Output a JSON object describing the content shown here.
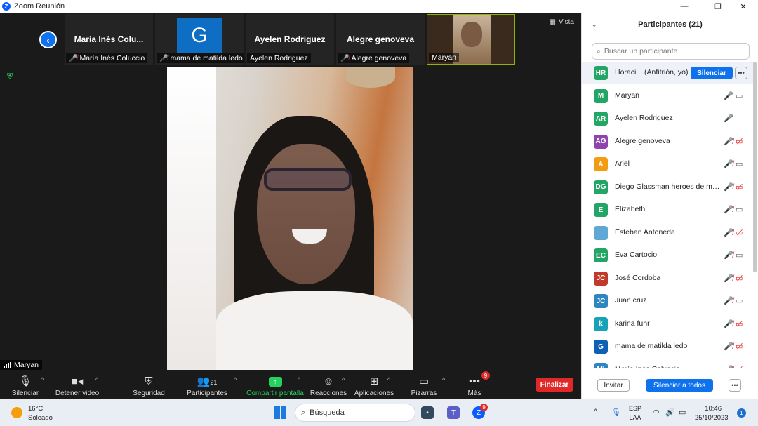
{
  "window": {
    "title": "Zoom Reunión",
    "minimize": "—",
    "maximize": "❐",
    "close": "✕"
  },
  "strip": {
    "tiles": [
      {
        "name": "María Inés Colu...",
        "label": "María Inés Coluccio",
        "muted": true
      },
      {
        "avatar": "G",
        "label": "mama de matilda ledo",
        "muted": true
      },
      {
        "name": "Ayelen Rodriguez",
        "label": "Ayelen Rodriguez",
        "muted": false
      },
      {
        "name": "Alegre genoveva",
        "label": "Alegre genoveva",
        "muted": true
      },
      {
        "label": "Maryan",
        "muted": false
      }
    ],
    "view_label": "Vista"
  },
  "speaker": {
    "name": "Maryan"
  },
  "toolbar": {
    "mute": "Silenciar",
    "video": "Detener video",
    "security": "Seguridad",
    "participants": "Participantes",
    "participants_count": "21",
    "share": "Compartir pantalla",
    "reactions": "Reacciones",
    "apps": "Aplicaciones",
    "whiteboards": "Pizarras",
    "more": "Más",
    "more_badge": "9",
    "end": "Finalizar"
  },
  "panel": {
    "title": "Participantes (21)",
    "search_placeholder": "Buscar un participante",
    "host_mute_button": "Silenciar",
    "participants": [
      {
        "initials": "HR",
        "name": "Horaci... (Anfitrión, yo)",
        "color": "#23a565",
        "mic": "",
        "cam": ""
      },
      {
        "initials": "M",
        "name": "Maryan",
        "color": "#23a565",
        "mic": "on",
        "cam": "on"
      },
      {
        "initials": "AR",
        "name": "Ayelen Rodriguez",
        "color": "#23a565",
        "mic": "on",
        "cam": ""
      },
      {
        "initials": "AG",
        "name": "Alegre genoveva",
        "color": "#8e44ad",
        "mic": "off",
        "cam": "off"
      },
      {
        "initials": "A",
        "name": "Ariel",
        "color": "#f39c12",
        "mic": "off",
        "cam": "on"
      },
      {
        "initials": "DG",
        "name": "Diego Glassman heroes de ma...",
        "color": "#23a565",
        "mic": "off",
        "cam": "off"
      },
      {
        "initials": "E",
        "name": "Elizabeth",
        "color": "#23a565",
        "mic": "off",
        "cam": "on"
      },
      {
        "initials": "",
        "name": "Esteban Antoneda",
        "color": "#5fa8d3",
        "mic": "off",
        "cam": "off"
      },
      {
        "initials": "EC",
        "name": "Eva Cartocio",
        "color": "#23a565",
        "mic": "off",
        "cam": "on"
      },
      {
        "initials": "JC",
        "name": "José Cordoba",
        "color": "#c0392b",
        "mic": "off",
        "cam": "off"
      },
      {
        "initials": "JC",
        "name": "Juan cruz",
        "color": "#2e86c1",
        "mic": "off",
        "cam": "on"
      },
      {
        "initials": "k",
        "name": "karina fuhr",
        "color": "#17a2b8",
        "mic": "off",
        "cam": "off"
      },
      {
        "initials": "G",
        "name": "mama de matilda ledo",
        "color": "#0e5fb5",
        "mic": "off",
        "cam": "off"
      },
      {
        "initials": "MI",
        "name": "María Inés Coluccio",
        "color": "#2e86c1",
        "mic": "off",
        "cam": "off"
      }
    ],
    "invite": "Invitar",
    "mute_all": "Silenciar a todos"
  },
  "taskbar": {
    "temperature": "16°C",
    "condition": "Soleado",
    "search": "Búsqueda",
    "zoom_badge": "9",
    "lang_top": "ESP",
    "lang_bottom": "LAA",
    "time": "10:46",
    "date": "25/10/2023",
    "notifications": "1"
  }
}
